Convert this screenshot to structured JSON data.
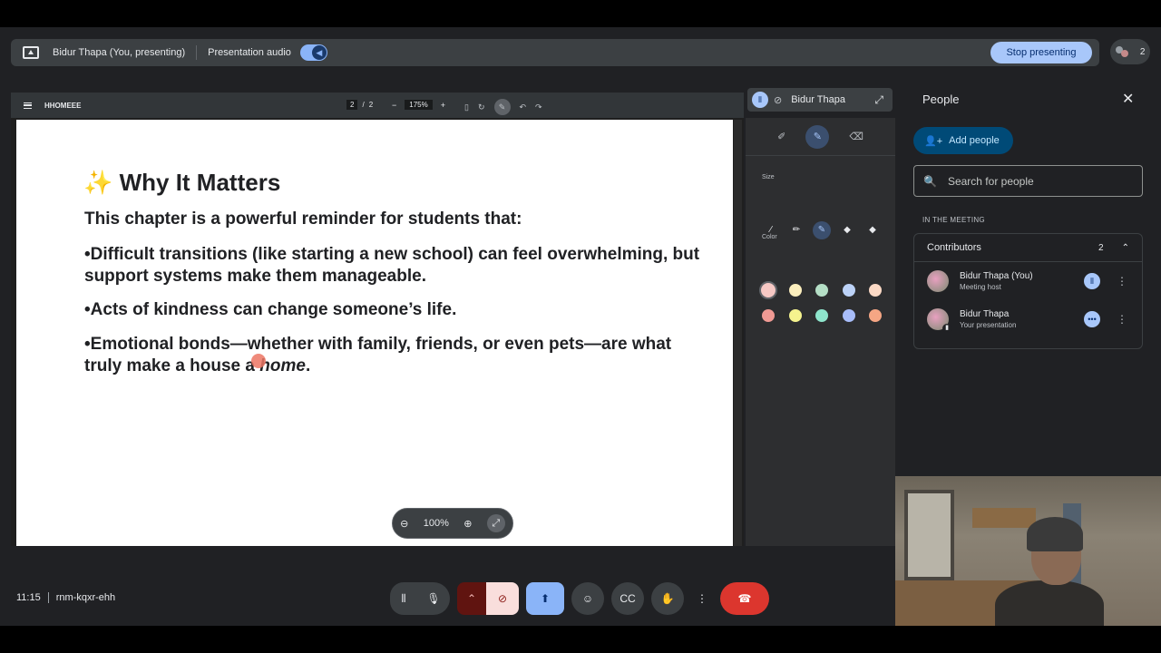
{
  "presenting_bar": {
    "presenter": "Bidur Thapa (You, presenting)",
    "audio_label": "Presentation audio",
    "stop_label": "Stop presenting",
    "participant_count": "2"
  },
  "viewer": {
    "doc_title": "HHOMEEE",
    "page_current": "2",
    "page_sep": "/",
    "page_total": "2",
    "zoom": "175%",
    "pill_zoom": "100%"
  },
  "slide": {
    "title": "✨ Why It Matters",
    "lead": "This chapter is a powerful reminder for students that:",
    "bullet1": "•Difficult transitions (like starting a new school) can feel overwhelming, but support systems make them manageable.",
    "bullet2": "•Acts of kindness can change someone’s life.",
    "bullet3_part1": "•Emotional bonds—whether with family, friends, or even pets—are what truly make a house a ",
    "bullet3_emph": "home",
    "bullet3_end": "."
  },
  "speaker_chip": {
    "name": "Bidur Thapa"
  },
  "annotation": {
    "size_label": "Size",
    "color_label": "Color",
    "colors_row1": [
      "#f6c8c4",
      "#fbeebd",
      "#b5dfc6",
      "#bcd2f7",
      "#fbd9c5"
    ],
    "colors_row2": [
      "#f09a94",
      "#f5f38e",
      "#8ee5cc",
      "#a8bdfa",
      "#f5a684"
    ]
  },
  "people": {
    "title": "People",
    "add_label": "Add people",
    "search_placeholder": "Search for people",
    "section_label": "IN THE MEETING",
    "group_label": "Contributors",
    "group_count": "2",
    "members": [
      {
        "name": "Bidur Thapa (You)",
        "role": "Meeting host"
      },
      {
        "name": "Bidur Thapa",
        "role": "Your presentation"
      }
    ]
  },
  "bottom": {
    "time": "11:15",
    "meeting_code": "rnm-kqxr-ehh"
  }
}
